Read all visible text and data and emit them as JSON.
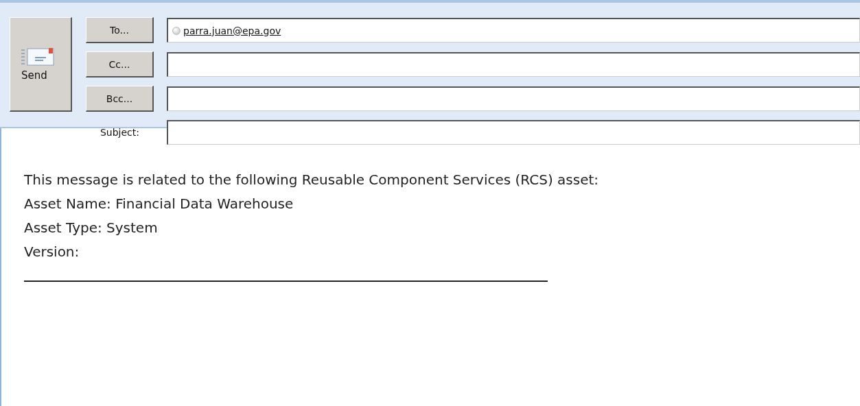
{
  "send_button": {
    "label": "Send"
  },
  "address_rows": [
    {
      "button": "To...",
      "value": "parra.juan@epa.gov"
    },
    {
      "button": "Cc..."
    },
    {
      "button": "Bcc..."
    }
  ],
  "subject": {
    "label": "Subject:"
  },
  "body": {
    "lines": [
      "This message is related to the following Reusable Component Services (RCS) asset:",
      "Asset Name: Financial Data Warehouse",
      "Asset Type: System",
      "Version:"
    ]
  }
}
